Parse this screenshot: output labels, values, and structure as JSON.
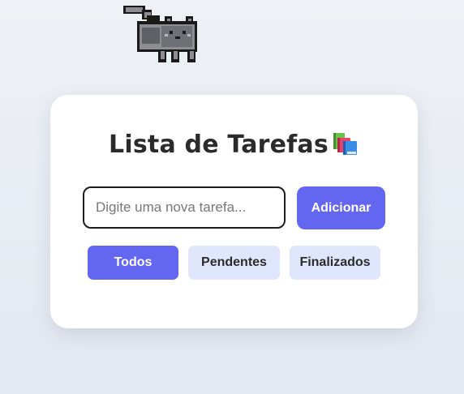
{
  "mascot": {
    "icon": "pixel-cat-icon"
  },
  "card": {
    "title": "Lista de Tarefas",
    "title_icon": "books-icon"
  },
  "input": {
    "value": "",
    "placeholder": "Digite uma nova tarefa..."
  },
  "add_button": {
    "label": "Adicionar"
  },
  "filters": [
    {
      "label": "Todos",
      "active": true
    },
    {
      "label": "Pendentes",
      "active": false
    },
    {
      "label": "Finalizados",
      "active": false
    }
  ],
  "colors": {
    "accent": "#6366f1",
    "filter_inactive": "#e0e6fb",
    "background": "#e3e8f1"
  }
}
